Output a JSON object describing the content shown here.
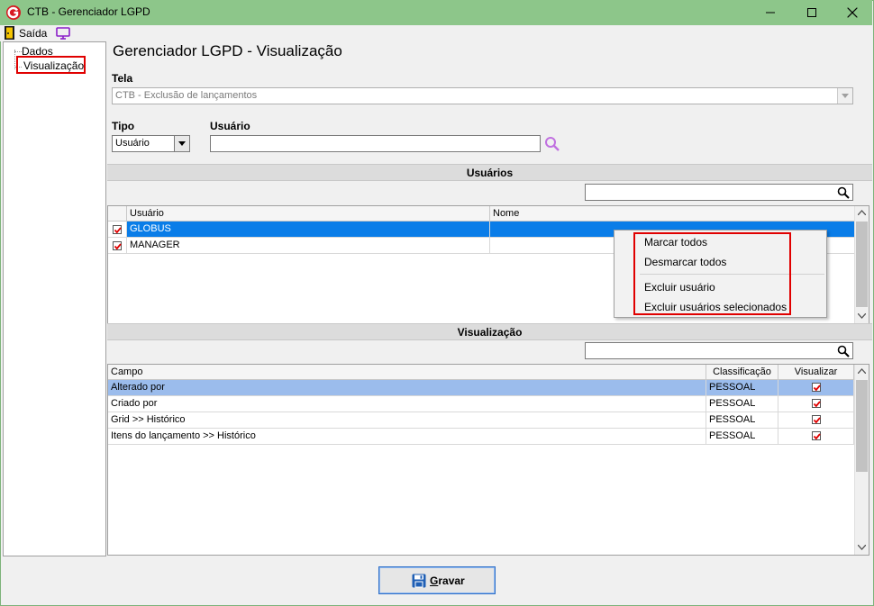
{
  "window": {
    "title": "CTB - Gerenciador LGPD"
  },
  "menu": {
    "exit_label": "Saída"
  },
  "tree": {
    "items": [
      {
        "label": "Dados"
      },
      {
        "label": "Visualização",
        "selected": true
      }
    ]
  },
  "page": {
    "title": "Gerenciador LGPD - Visualização"
  },
  "form": {
    "tela_label": "Tela",
    "tela_value": "CTB - Exclusão de lançamentos",
    "tipo_label": "Tipo",
    "tipo_value": "Usuário",
    "usuario_label": "Usuário",
    "usuario_value": ""
  },
  "usuarios_section": {
    "title": "Usuários",
    "search_value": "",
    "columns": [
      "Usuário",
      "Nome"
    ],
    "rows": [
      {
        "checked": true,
        "usuario": "GLOBUS",
        "nome": "",
        "selected": true
      },
      {
        "checked": true,
        "usuario": "MANAGER",
        "nome": "",
        "selected": false
      }
    ]
  },
  "context_menu": {
    "items": [
      "Marcar todos",
      "Desmarcar todos",
      "Excluir usuário",
      "Excluir usuários selecionados"
    ]
  },
  "visualizacao_section": {
    "title": "Visualização",
    "search_value": "",
    "columns": [
      "Campo",
      "Classificação",
      "Visualizar"
    ],
    "rows": [
      {
        "campo": "Alterado por",
        "classificacao": "PESSOAL",
        "visualizar": true,
        "selected": true
      },
      {
        "campo": "Criado por",
        "classificacao": "PESSOAL",
        "visualizar": true,
        "selected": false
      },
      {
        "campo": "Grid >> Histórico",
        "classificacao": "PESSOAL",
        "visualizar": true,
        "selected": false
      },
      {
        "campo": "Itens do lançamento >> Histórico",
        "classificacao": "PESSOAL",
        "visualizar": true,
        "selected": false
      }
    ]
  },
  "actions": {
    "save_label": "Gravar"
  },
  "colors": {
    "titlebar": "#8dc68a",
    "selection": "#0a7de8",
    "highlight": "#e00000",
    "check": "#e00000"
  }
}
